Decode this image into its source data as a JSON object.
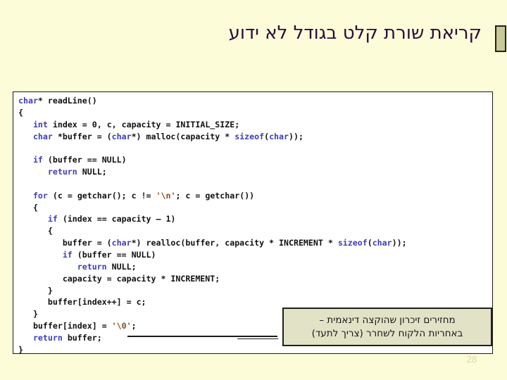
{
  "slide": {
    "title": "קריאת שורת קלט בגודל לא ידוע",
    "page_number": "28",
    "background_color": "#fcfcd8",
    "title_color": "#2b0b3a"
  },
  "corner_marker": {
    "fill_color": "#c9c897",
    "border_color": "#20201c"
  },
  "code_block": {
    "background_color": "#ffffff",
    "border_color": "#1a1a1a",
    "language": "c",
    "keyword_color": "#3b3bbf",
    "string_color": "#8a4b20",
    "plain_color": "#101010",
    "lines": [
      "char* readLine()",
      "{",
      "   int index = 0, c, capacity = INITIAL_SIZE;",
      "   char *buffer = (char*) malloc(capacity * sizeof(char));",
      "",
      "   if (buffer == NULL)",
      "      return NULL;",
      "",
      "   for (c = getchar(); c != '\\n'; c = getchar())",
      "   {",
      "      if (index == capacity – 1)",
      "      {",
      "         buffer = (char*) realloc(buffer, capacity * INCREMENT * sizeof(char));",
      "         if (buffer == NULL)",
      "            return NULL;",
      "         capacity = capacity * INCREMENT;",
      "      }",
      "      buffer[index++] = c;",
      "   }",
      "   buffer[index] = '\\0';",
      "   return buffer;",
      "}"
    ]
  },
  "callout": {
    "line1": "מחזירים זיכרון שהוקצה דינאמית –",
    "line2": "באחריות הלקוח לשחרר (צריך לתעד)",
    "background_color": "#e2e2c6",
    "border_color": "#20201c"
  }
}
